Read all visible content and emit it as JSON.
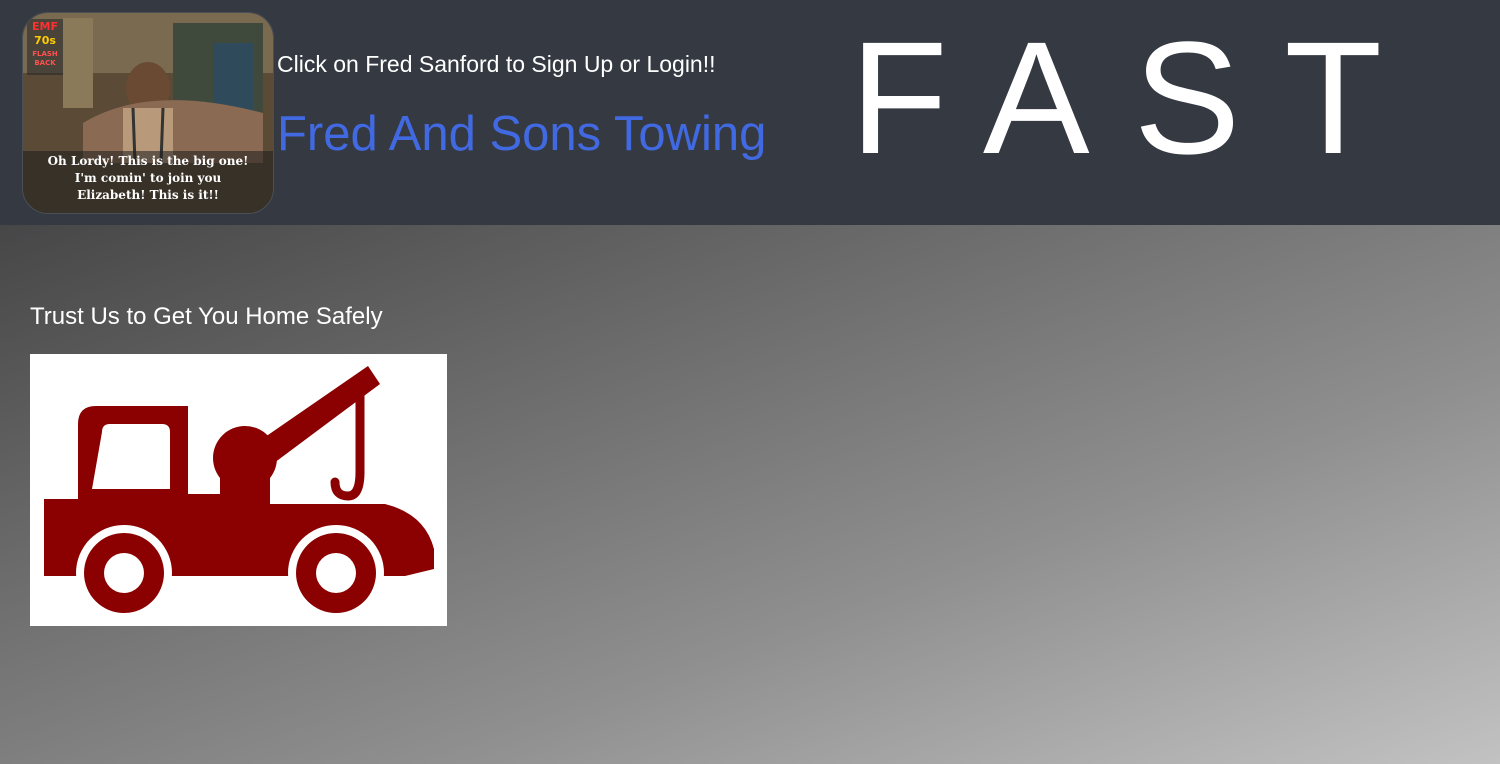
{
  "header": {
    "profile_image": {
      "badge_lines": [
        "EMF",
        "70s",
        "FLASH",
        "BACK"
      ],
      "caption_lines": [
        "Oh Lordy! This is the big one!",
        "I'm comin' to join you",
        "Elizabeth! This is it!!"
      ]
    },
    "signup_text": "Click on Fred Sanford to Sign Up or Login!!",
    "brand_title": "Fred And Sons Towing",
    "fast_text": "FAST"
  },
  "main": {
    "tagline": "Trust Us to Get You Home Safely",
    "truck_icon": "tow-truck-icon"
  },
  "colors": {
    "header_bg": "#353a42",
    "brand_blue": "#4169e1",
    "truck_red": "#8b0000"
  }
}
